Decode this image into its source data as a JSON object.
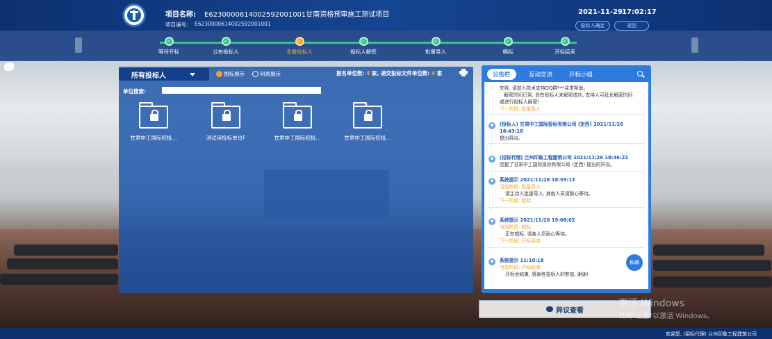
{
  "header": {
    "project_name_label": "项目名称:",
    "project_name_value": "E6230000614002592001001甘南资格预审施工测试项目",
    "project_no_label": "项目编号:",
    "project_no_value": "E6230000614002592001001",
    "date": "2021-11-29",
    "time": "17:02:17",
    "confirm_button": "投标人确定",
    "back_button": "返回"
  },
  "progress": {
    "steps": [
      {
        "label": "等待开标",
        "state": "done"
      },
      {
        "label": "公布投标人",
        "state": "done"
      },
      {
        "label": "查看投标人",
        "state": "active"
      },
      {
        "label": "投标人解密",
        "state": "done"
      },
      {
        "label": "批量导入",
        "state": "done"
      },
      {
        "label": "唱标",
        "state": "done"
      },
      {
        "label": "开标结束",
        "state": "done"
      }
    ],
    "check_mark": "✓"
  },
  "main": {
    "filter_label": "所有投标人",
    "view_icon": "图标展示",
    "view_list": "列表展示",
    "count_label_1": "报名单位数: ",
    "count_value_1": "4",
    "count_label_2": " 家, 递交投标文件单位数: ",
    "count_value_2": "4",
    "count_label_3": " 家",
    "search_label": "单位搜索:",
    "search_value": "",
    "bidders": [
      {
        "label": "甘肃中工国际招投..."
      },
      {
        "label": "测试用投标单位F"
      },
      {
        "label": "甘肃中工国际招投..."
      },
      {
        "label": "甘肃中工国际招投..."
      }
    ]
  },
  "side": {
    "tabs": [
      "公告栏",
      "互动交流",
      "开标小组"
    ],
    "messages": [
      {
        "lines": [
          "失败, 请加入技术支持QQ群***寻求帮助。",
          "解密时间已到, 尚有投标人未解密成功, 支持人可延长解密时间",
          "或进行投标人解密!"
        ],
        "next": "下一阶段: 批量导入"
      },
      {
        "title": "(投标人) 甘肃中工国际投标有限公司 (定西) 2021/11/26",
        "title2": "18:43:18",
        "body": "提出异议。"
      },
      {
        "title": "(招标代理) 兰州印象工程建筑公司 2021/11/26 18:46:21",
        "body": "回复了甘肃中工国际投标有限公司 (定西) 提出的异议。"
      },
      {
        "title": "系统提示 2021/11/26 18:59:13",
        "stage": "当前阶段: 批量导入",
        "body": "请主持人批量导入, 其他人员请耐心等待。",
        "next": "下一阶段: 唱标"
      },
      {
        "title": "系统提示 2021/11/26 19:08:02",
        "stage": "当前阶段: 唱标",
        "body": "正在唱标, 请各人员耐心等待。",
        "next": "下一阶段: 开标结束"
      },
      {
        "title": "系统提示 11:10:18",
        "stage": "当前阶段: 开标结束",
        "body": "开标会结束, 感谢各投标人的参加, 谢谢!"
      }
    ],
    "private_msg": "私聊"
  },
  "objection_button": "异议查看",
  "watermark": {
    "line1": "激活 Windows",
    "line2": "转到\"设置\"以激活 Windows。"
  },
  "footer": "欢迎您, (招标代理) 兰州印象工程建筑公司"
}
